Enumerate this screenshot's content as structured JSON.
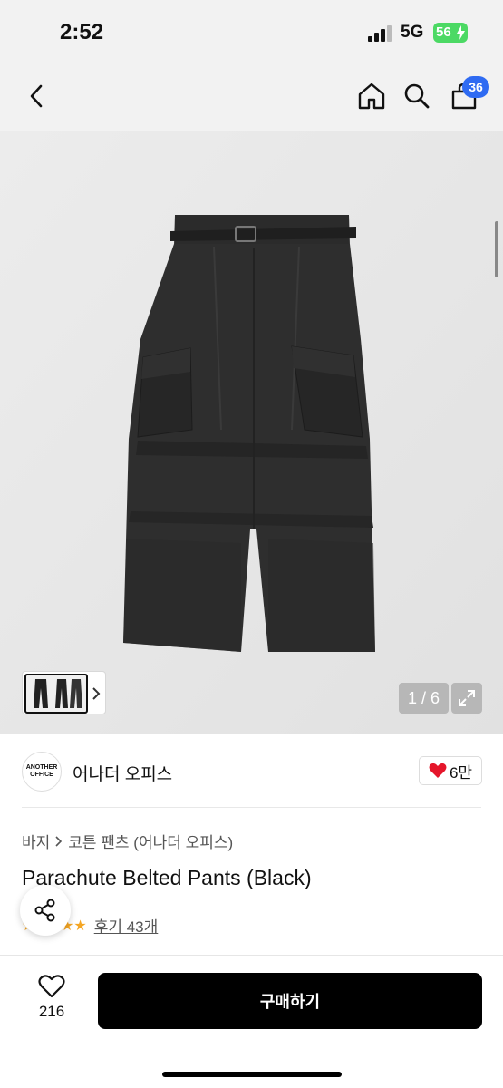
{
  "status": {
    "time": "2:52",
    "network": "5G",
    "battery": "56"
  },
  "header": {
    "cart_count": "36"
  },
  "gallery": {
    "counter": "1 / 6"
  },
  "brand": {
    "logo_line1": "ANOTHER",
    "logo_line2": "OFFICE",
    "name": "어나더 오피스",
    "likes": "6만"
  },
  "breadcrumb": {
    "level1": "바지",
    "level2": "코튼 팬츠 (어나더 오피스)"
  },
  "product": {
    "title": "Parachute Belted Pants (Black)",
    "reviews": "후기 43개"
  },
  "footer": {
    "wish_count": "216",
    "buy_label": "구매하기"
  },
  "colors": {
    "accent": "#2f6bf2",
    "like": "#e5162b",
    "buy_bg": "#000000",
    "battery": "#4cd964"
  }
}
